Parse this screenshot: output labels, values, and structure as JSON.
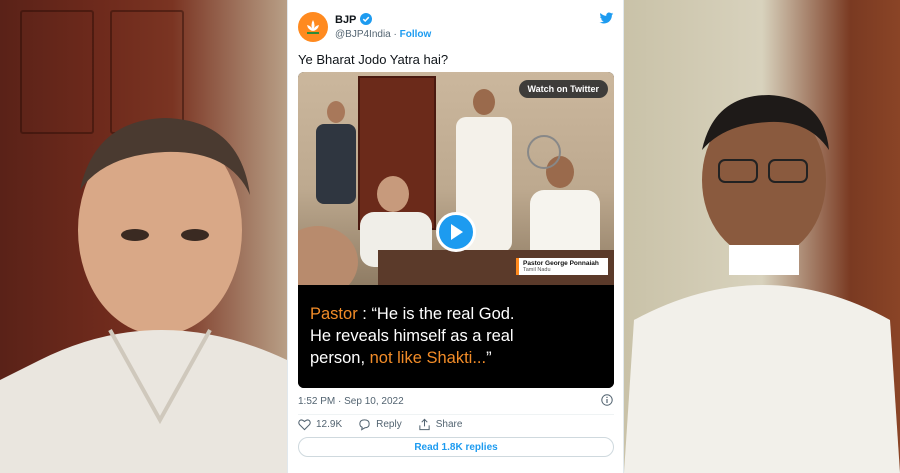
{
  "tweet": {
    "account_name": "BJP",
    "handle": "@BJP4India",
    "separator": "·",
    "follow_label": "Follow",
    "text": "Ye Bharat Jodo Yatra hai?",
    "timestamp": "1:52 PM · Sep 10, 2022",
    "likes": "12.9K",
    "reply_label": "Reply",
    "share_label": "Share",
    "read_replies_label": "Read 1.8K replies"
  },
  "media": {
    "watch_label": "Watch on Twitter",
    "caption_name": "Pastor George Ponnaiah",
    "caption_place": "Tamil Nadu",
    "quote": {
      "line1_speaker": "Pastor",
      "line1_rest": " : “He is the real God.",
      "line2": "He reveals himself as a real",
      "line3_plain": "person, ",
      "line3_highlight": "not like Shakti...",
      "line3_end": "”"
    }
  },
  "colors": {
    "twitter_blue": "#1d9bf0",
    "bjp_saffron": "#ff8a1f",
    "quote_highlight": "#f28c28"
  },
  "icons": [
    "lotus-icon",
    "verified-badge-icon",
    "twitter-bird-icon",
    "play-icon",
    "info-icon",
    "heart-icon",
    "reply-icon",
    "share-icon"
  ]
}
